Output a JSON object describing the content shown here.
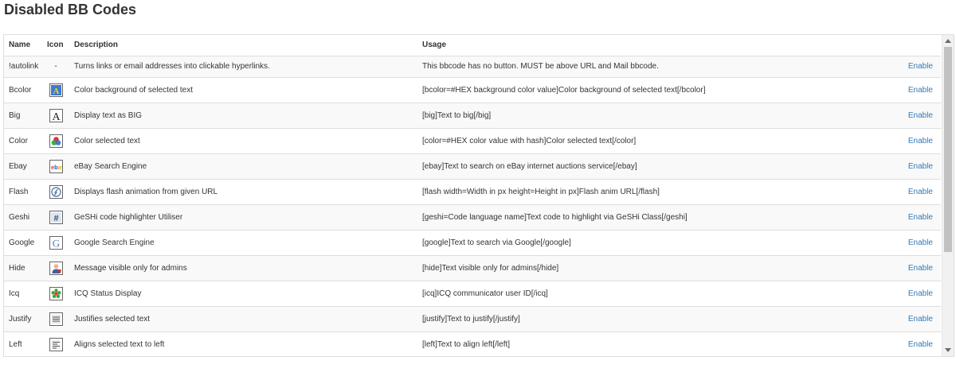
{
  "page": {
    "title": "Disabled BB Codes"
  },
  "table": {
    "headers": {
      "name": "Name",
      "icon": "Icon",
      "description": "Description",
      "usage": "Usage",
      "action": ""
    },
    "rows": [
      {
        "name": "!autolink",
        "icon": "none",
        "icon_text": "-",
        "description": "Turns links or email addresses into clickable hyperlinks.",
        "usage": "This bbcode has no button. MUST be above URL and Mail bbcode.",
        "action": "Enable"
      },
      {
        "name": "Bcolor",
        "icon": "bcolor-icon",
        "description": "Color background of selected text",
        "usage": "[bcolor=#HEX background color value]Color background of selected text[/bcolor]",
        "action": "Enable"
      },
      {
        "name": "Big",
        "icon": "big-text-icon",
        "description": "Display text as BIG",
        "usage": "[big]Text to big[/big]",
        "action": "Enable"
      },
      {
        "name": "Color",
        "icon": "color-icon",
        "description": "Color selected text",
        "usage": "[color=#HEX color value with hash]Color selected text[/color]",
        "action": "Enable"
      },
      {
        "name": "Ebay",
        "icon": "ebay-icon",
        "description": "eBay Search Engine",
        "usage": "[ebay]Text to search on eBay internet auctions service[/ebay]",
        "action": "Enable"
      },
      {
        "name": "Flash",
        "icon": "flash-icon",
        "description": "Displays flash animation from given URL",
        "usage": "[flash width=Width in px height=Height in px]Flash anim URL[/flash]",
        "action": "Enable"
      },
      {
        "name": "Geshi",
        "icon": "geshi-icon",
        "description": "GeSHi code highlighter Utiliser",
        "usage": "[geshi=Code language name]Text code to highlight via GeSHi Class[/geshi]",
        "action": "Enable"
      },
      {
        "name": "Google",
        "icon": "google-icon",
        "description": "Google Search Engine",
        "usage": "[google]Text to search via Google[/google]",
        "action": "Enable"
      },
      {
        "name": "Hide",
        "icon": "hide-icon",
        "description": "Message visible only for admins",
        "usage": "[hide]Text visible only for admins[/hide]",
        "action": "Enable"
      },
      {
        "name": "Icq",
        "icon": "icq-icon",
        "description": "ICQ Status Display",
        "usage": "[icq]ICQ communicator user ID[/icq]",
        "action": "Enable"
      },
      {
        "name": "Justify",
        "icon": "justify-icon",
        "description": "Justifies selected text",
        "usage": "[justify]Text to justify[/justify]",
        "action": "Enable"
      },
      {
        "name": "Left",
        "icon": "align-left-icon",
        "description": "Aligns selected text to left",
        "usage": "[left]Text to align left[/left]",
        "action": "Enable"
      }
    ]
  },
  "colors": {
    "link": "#337ab7",
    "border": "#dddddd",
    "stripe": "#f9f9f9"
  }
}
